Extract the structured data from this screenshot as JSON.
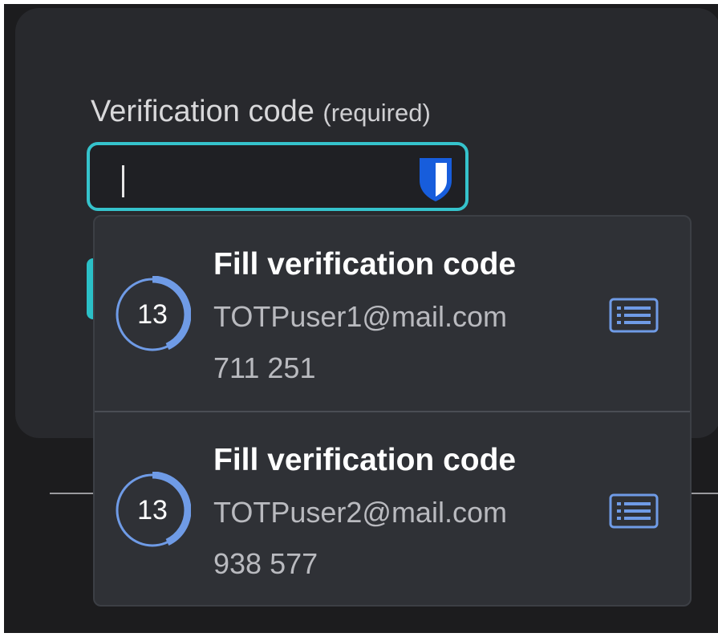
{
  "form": {
    "label": "Verification code",
    "label_suffix": "(required)",
    "input_value": "",
    "accent_color": "#35c3cc"
  },
  "autofill": {
    "brand_color": "#175ddc",
    "options": [
      {
        "title": "Fill verification code",
        "username": "TOTPuser1@mail.com",
        "code": "711 251",
        "seconds_remaining": "13",
        "timer_fraction": 0.43,
        "icon": "list-card-icon"
      },
      {
        "title": "Fill verification code",
        "username": "TOTPuser2@mail.com",
        "code": "938 577",
        "seconds_remaining": "13",
        "timer_fraction": 0.43,
        "icon": "list-card-icon"
      }
    ]
  }
}
